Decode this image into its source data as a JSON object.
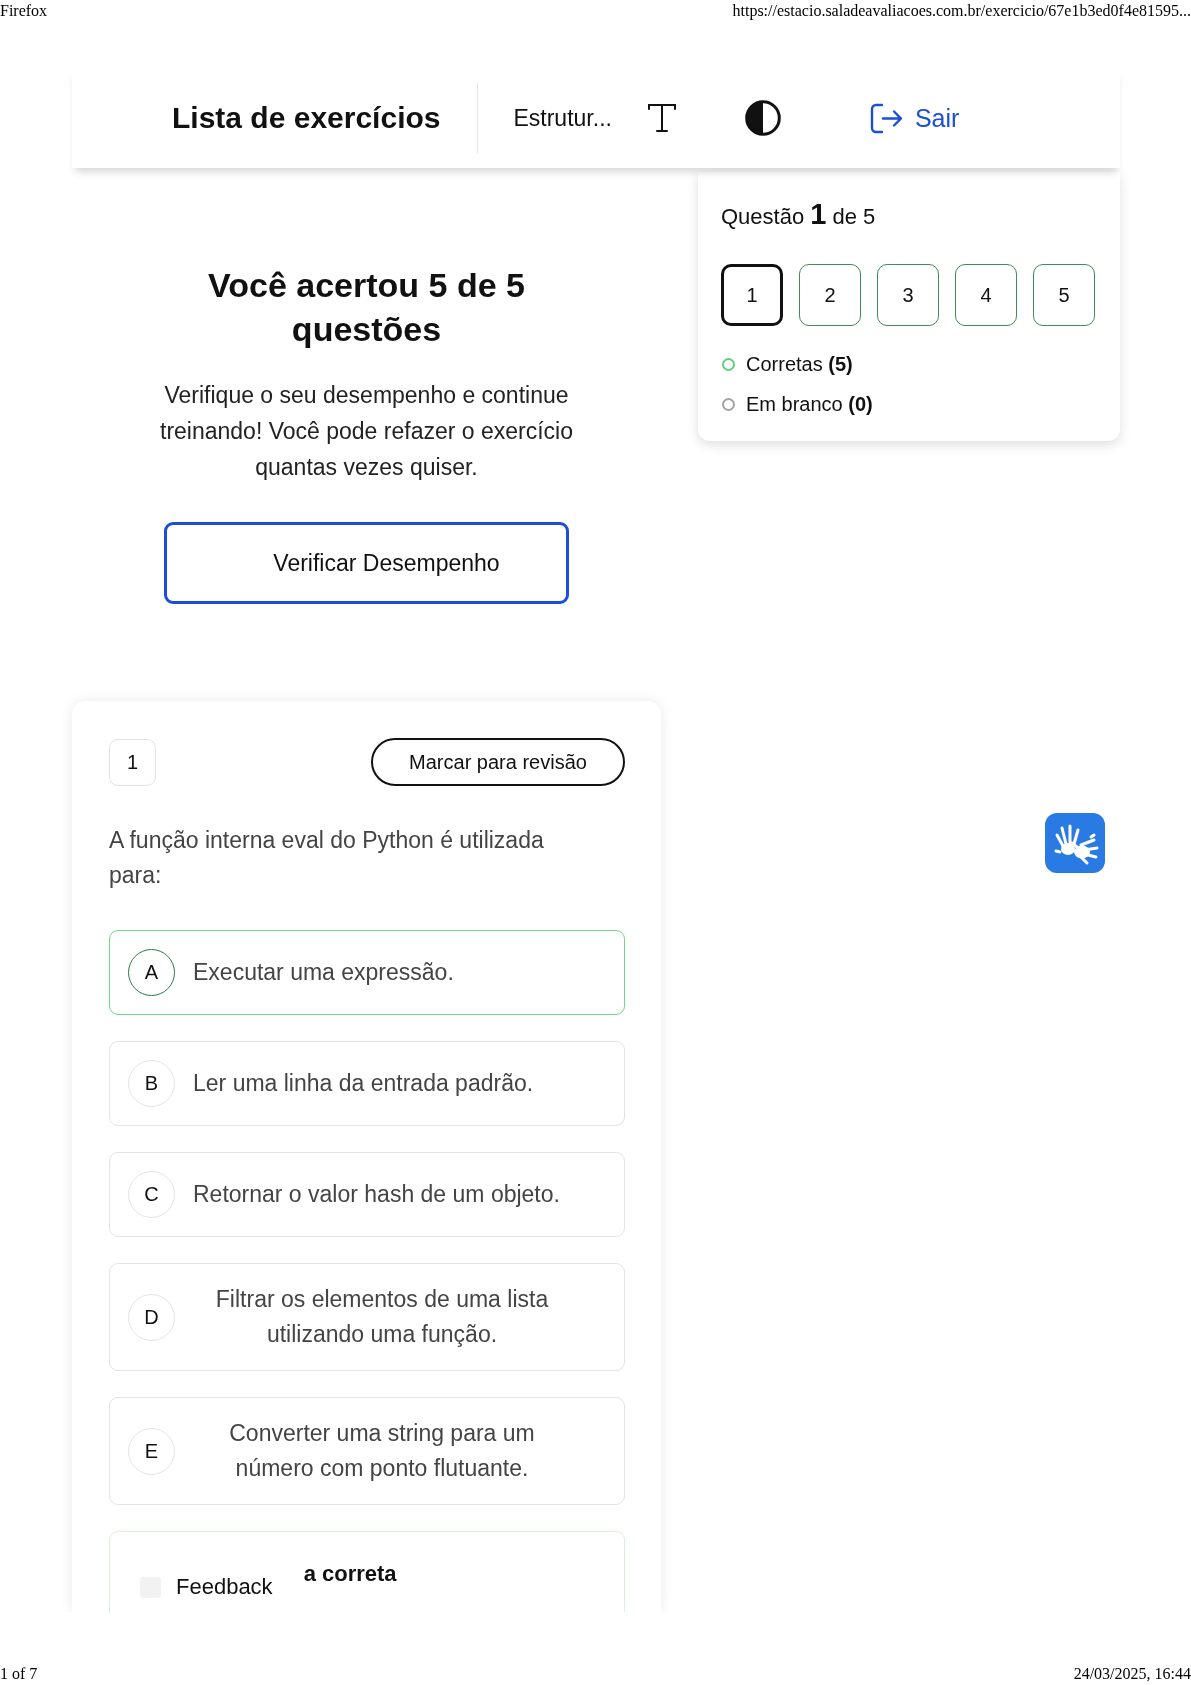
{
  "print_header": {
    "app": "Firefox",
    "url": "https://estacio.saladeavaliacoes.com.br/exercicio/67e1b3ed0f4e81595..."
  },
  "nav": {
    "title": "Lista de exercícios",
    "subject": "Estrutur...",
    "logout": "Sair"
  },
  "summary": {
    "heading": "Você acertou 5 de 5 questões",
    "text": "Verifique o seu desempenho e continue treinando! Você pode refazer o exercício quantas vezes quiser.",
    "button": "Verificar Desempenho"
  },
  "navigator": {
    "title": "Questão **1** de 5",
    "questions": [
      {
        "label": "1",
        "selected": true,
        "correct": true
      },
      {
        "label": "2",
        "selected": false,
        "correct": true
      },
      {
        "label": "3",
        "selected": false,
        "correct": true
      },
      {
        "label": "4",
        "selected": false,
        "correct": true
      },
      {
        "label": "5",
        "selected": false,
        "correct": true
      }
    ],
    "legend": [
      {
        "label": "Corretas **(5)**",
        "color": "#5fd07a"
      },
      {
        "label": "Em branco **(0)**",
        "color": "#a3a3a3"
      }
    ]
  },
  "question": {
    "number": "1",
    "review_button": "Marcar para revisão",
    "prompt": "A função interna eval do Python é utilizada para:",
    "options": [
      {
        "letter": "A",
        "text": "Executar uma expressão.",
        "correct": true
      },
      {
        "letter": "B",
        "text": "Ler uma linha da entrada padrão.",
        "correct": false
      },
      {
        "letter": "C",
        "text": "Retornar o valor hash de um objeto.",
        "correct": false
      },
      {
        "letter": "D",
        "text": "Filtrar os elementos de uma lista utilizando uma função.",
        "correct": false
      },
      {
        "letter": "E",
        "text": "Converter uma string para um número com ponto flutuante.",
        "correct": false
      }
    ],
    "feedback": {
      "label": "Feedback",
      "text": "a correta"
    }
  },
  "footer": {
    "page": "1 of 7",
    "datetime": "24/03/2025, 16:44"
  }
}
